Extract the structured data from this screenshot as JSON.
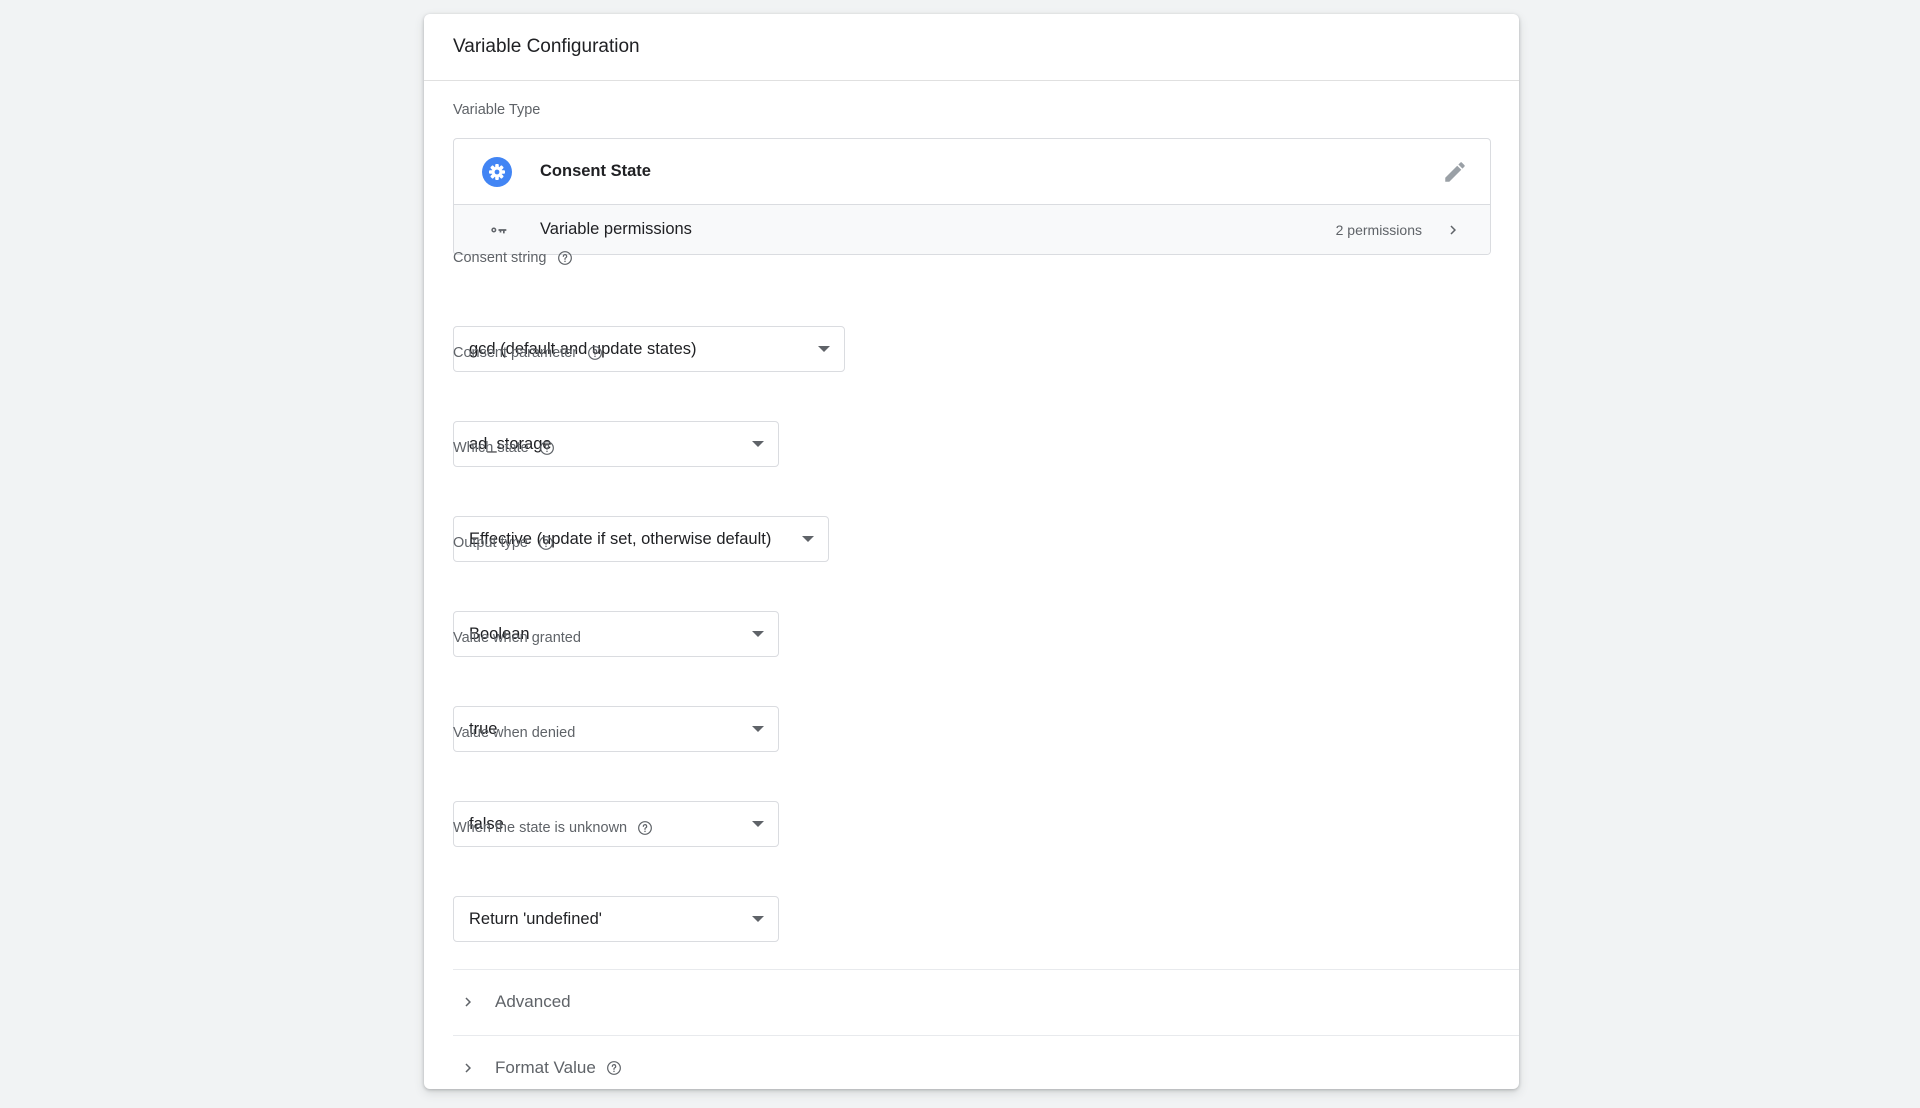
{
  "card": {
    "title": "Variable Configuration"
  },
  "variable_type": {
    "section_label": "Variable Type",
    "name": "Consent State",
    "permissions_label": "Variable permissions",
    "permissions_count": "2 permissions",
    "icon_color": "#4285f4"
  },
  "fields": {
    "consent_string": {
      "label": "Consent string",
      "value": "gcd (default and update states)"
    },
    "consent_parameter": {
      "label": "Consent parameter",
      "value": "ad_storage"
    },
    "which_state": {
      "label": "Which state",
      "value": "Effective (update if set, otherwise default)"
    },
    "output_type": {
      "label": "Output type",
      "value": "Boolean"
    },
    "value_granted": {
      "label": "Value when granted",
      "value": "true"
    },
    "value_denied": {
      "label": "Value when denied",
      "value": "false"
    },
    "state_unknown": {
      "label": "When the state is unknown",
      "value": "Return 'undefined'"
    }
  },
  "sections": {
    "advanced": "Advanced",
    "format_value": "Format Value"
  },
  "icons": {
    "type": "gear-icon",
    "edit": "pencil-icon",
    "permissions": "key-icon",
    "chevron": "chevron-right-icon",
    "help": "help-circle-icon",
    "dropdown": "caret-down-icon"
  }
}
